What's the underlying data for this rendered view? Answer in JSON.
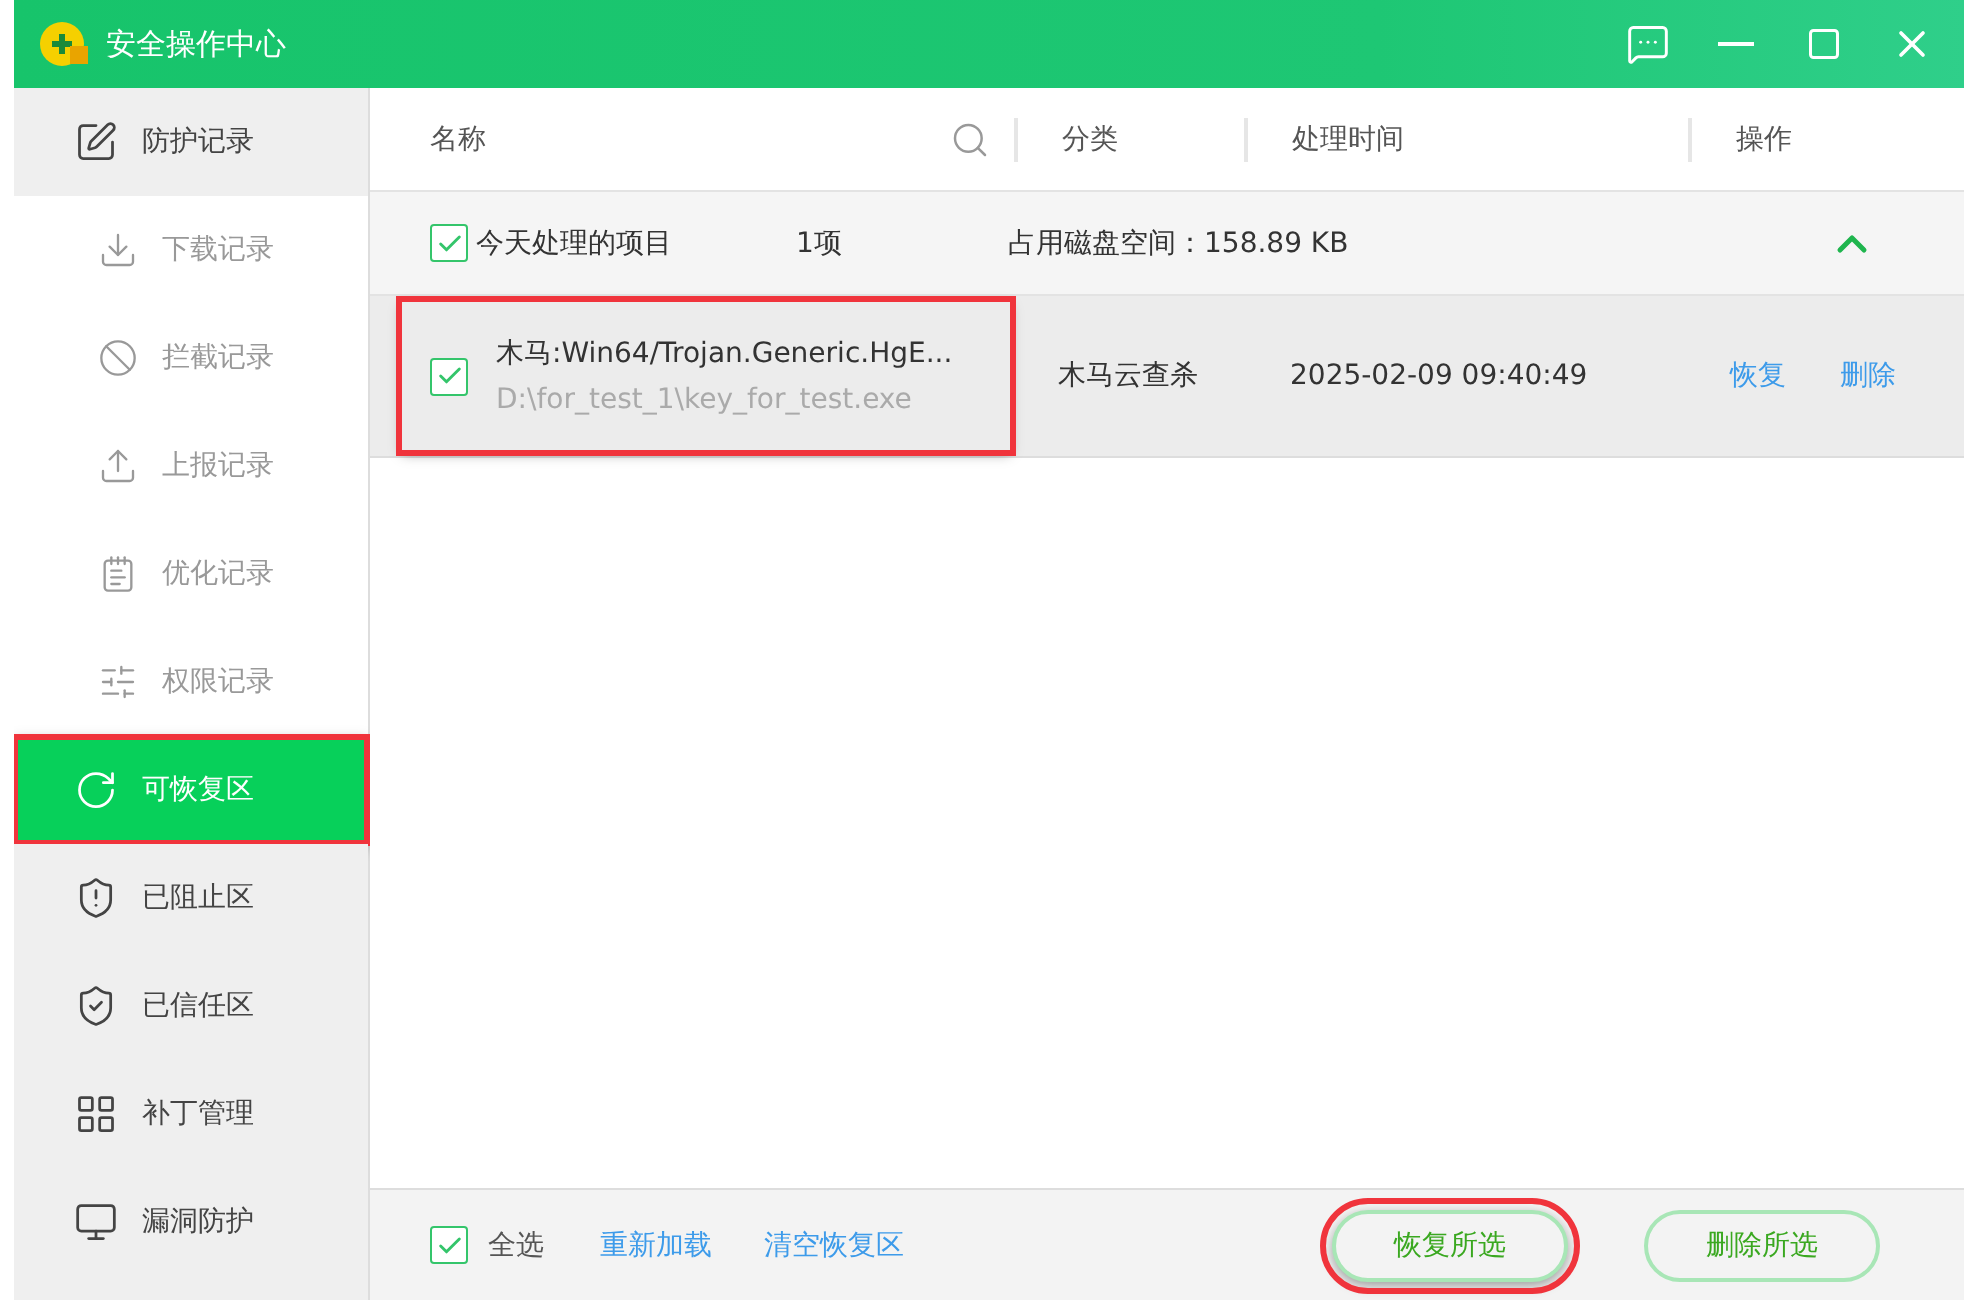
{
  "window": {
    "title": "安全操作中心"
  },
  "sidebar": {
    "items": [
      {
        "label": "防护记录",
        "selected": false,
        "children": [
          {
            "label": "下载记录",
            "selected": false
          },
          {
            "label": "拦截记录",
            "selected": false
          },
          {
            "label": "上报记录",
            "selected": false
          },
          {
            "label": "优化记录",
            "selected": false
          },
          {
            "label": "权限记录",
            "selected": false
          }
        ]
      },
      {
        "label": "可恢复区",
        "selected": true,
        "highlighted": true
      },
      {
        "label": "已阻止区",
        "selected": false
      },
      {
        "label": "已信任区",
        "selected": false
      },
      {
        "label": "补丁管理",
        "selected": false
      },
      {
        "label": "漏洞防护",
        "selected": false
      }
    ]
  },
  "table": {
    "columns": [
      "名称",
      "分类",
      "处理时间",
      "操作"
    ],
    "group": {
      "label": "今天处理的项目",
      "checked": true,
      "count": "1项",
      "disk_usage": "占用磁盘空间：158.89 KB",
      "expanded": true
    },
    "rows": [
      {
        "name": "木马:Win64/Trojan.Generic.HgE...",
        "path": "D:\\for_test_1\\key_for_test.exe",
        "checked": true,
        "highlighted": true,
        "category": "木马云查杀",
        "time": "2025-02-09 09:40:49",
        "actions": [
          "恢复",
          "删除"
        ]
      }
    ]
  },
  "footer": {
    "select_all": {
      "label": "全选",
      "checked": true
    },
    "links": [
      "重新加载",
      "清空恢复区"
    ],
    "buttons": [
      {
        "label": "恢复所选",
        "highlighted": true
      },
      {
        "label": "删除所选",
        "highlighted": false
      }
    ]
  }
}
